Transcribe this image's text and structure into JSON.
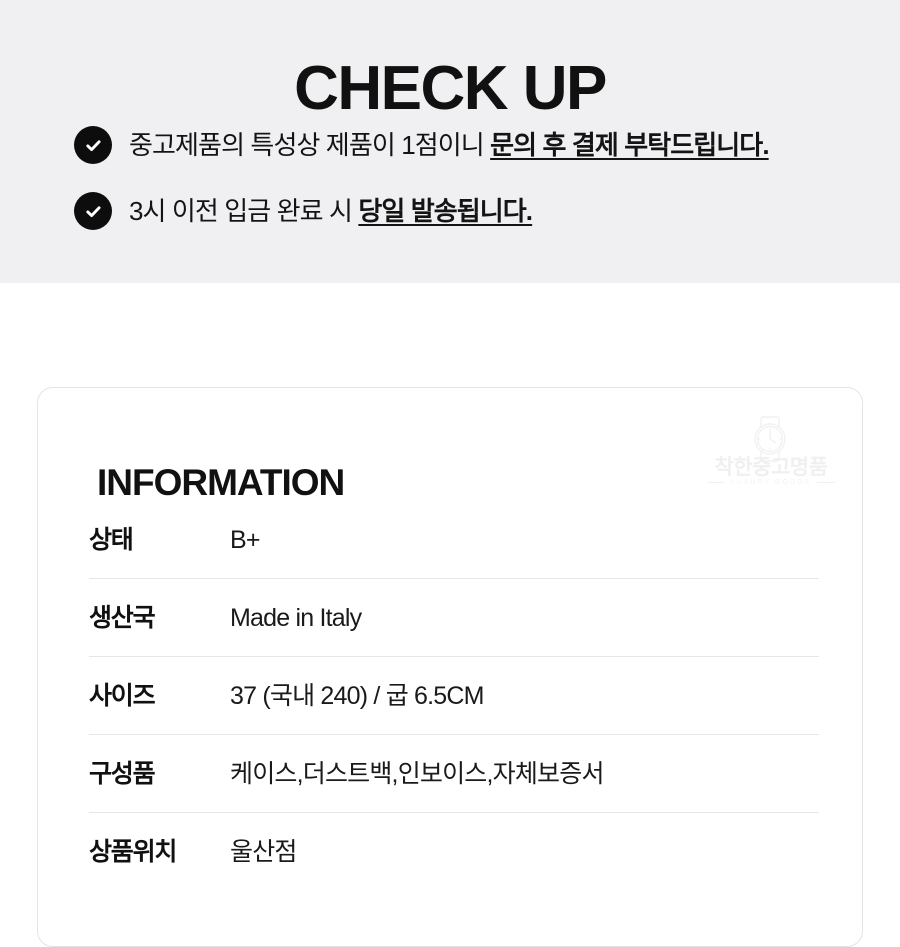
{
  "checkup": {
    "title": "CHECK UP",
    "notices": [
      {
        "icon": "check-circle-icon",
        "plain_before": "중고제품의 특성상 제품이 1점이니 ",
        "emphasis": "문의 후 결제 부탁드립니다.",
        "plain_after": ""
      },
      {
        "icon": "check-circle-icon",
        "plain_before": "3시 이전 입금 완료 시 ",
        "emphasis": "당일 발송됩니다.",
        "plain_after": ""
      }
    ]
  },
  "information": {
    "title": "INFORMATION",
    "brand": {
      "name": "착한중고명품",
      "tagline": "LUXURY GOODS",
      "icon": "wristwatch-icon"
    },
    "rows": [
      {
        "label": "상태",
        "value": "B+"
      },
      {
        "label": "생산국",
        "value": "Made in Italy"
      },
      {
        "label": "사이즈",
        "value": "37 (국내 240) / 굽 6.5CM"
      },
      {
        "label": "구성품",
        "value": "케이스,더스트백,인보이스,자체보증서"
      },
      {
        "label": "상품위치",
        "value": "울산점"
      }
    ]
  },
  "colors": {
    "band_background": "#f0f0f2",
    "page_background": "#ffffff",
    "text_primary": "#111111",
    "bullet_fill": "#0d0d0d",
    "divider": "#e6e6e8",
    "card_border": "#e4e4e6",
    "watermark": "#f0f0f0"
  }
}
